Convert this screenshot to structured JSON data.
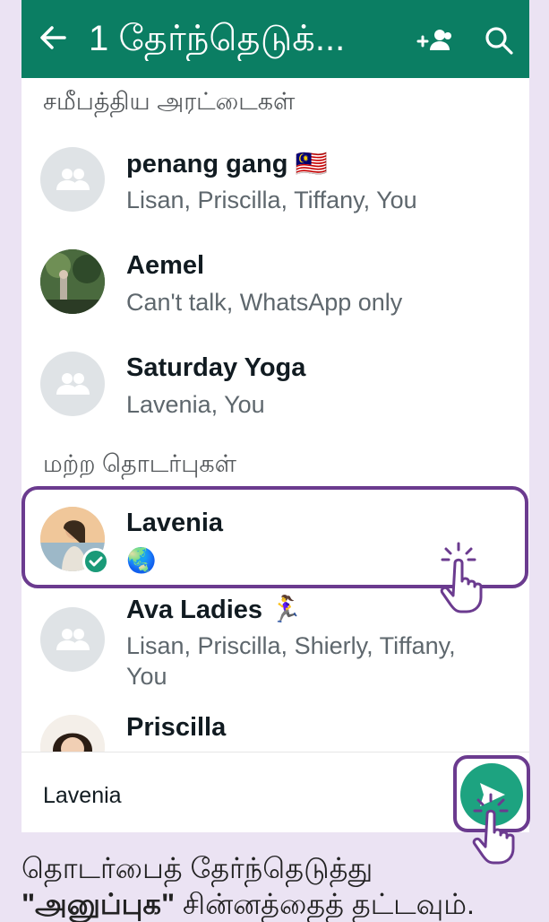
{
  "appbar": {
    "title": "1 தேர்ந்தெடுக்...",
    "back_icon": "arrow-back-icon",
    "new_group_icon": "add-people-icon",
    "search_icon": "search-icon",
    "color": "#0b7e63"
  },
  "recent": {
    "label": "சமீபத்திய அரட்டைகள்",
    "items": [
      {
        "name": "penang gang 🇲🇾",
        "sub": "Lisan, Priscilla, Tiffany, You"
      },
      {
        "name": "Aemel",
        "sub": "Can't talk, WhatsApp only"
      },
      {
        "name": "Saturday Yoga",
        "sub": "Lavenia, You"
      }
    ]
  },
  "others": {
    "label": "மற்ற தொடர்புகள்",
    "items": [
      {
        "name": "Lavenia",
        "sub": "🌏",
        "selected": true
      },
      {
        "name": "Ava Ladies 🏃‍♀️",
        "sub": "Lisan, Priscilla, Shierly, Tiffany,",
        "sub2": "You"
      },
      {
        "name": "Priscilla",
        "sub": ""
      }
    ]
  },
  "bottom": {
    "selected_names": "Lavenia",
    "send_icon": "send-icon"
  },
  "instruction": {
    "line1": "தொடர்பைத் தேர்ந்தெடுத்து",
    "bold": "\"அனுப்புக\"",
    "line2_rest": " சின்னத்தைத் தட்டவும்."
  },
  "colors": {
    "accent": "#0b7e63",
    "highlight": "#6b3b8f",
    "send": "#1da380"
  }
}
